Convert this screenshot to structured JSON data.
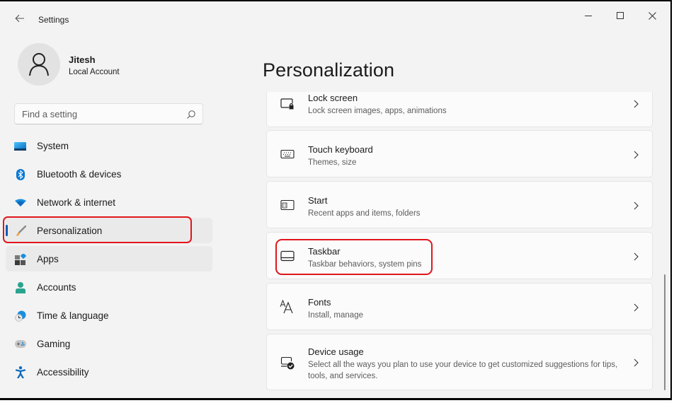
{
  "window": {
    "title": "Settings",
    "controls": {
      "minimize": "minimize-icon",
      "maximize": "maximize-icon",
      "close": "close-icon"
    }
  },
  "profile": {
    "name": "Jitesh",
    "account_type": "Local Account",
    "avatar_icon": "person-icon"
  },
  "search": {
    "placeholder": "Find a setting",
    "value": "",
    "icon": "search-icon"
  },
  "sidebar": {
    "items": [
      {
        "label": "System",
        "icon": "system-icon",
        "selected": false
      },
      {
        "label": "Bluetooth & devices",
        "icon": "bluetooth-icon",
        "selected": false
      },
      {
        "label": "Network & internet",
        "icon": "wifi-icon",
        "selected": false
      },
      {
        "label": "Personalization",
        "icon": "brush-icon",
        "selected": true
      },
      {
        "label": "Apps",
        "icon": "apps-icon",
        "selected": false
      },
      {
        "label": "Accounts",
        "icon": "account-icon",
        "selected": false
      },
      {
        "label": "Time & language",
        "icon": "clock-globe-icon",
        "selected": false
      },
      {
        "label": "Gaming",
        "icon": "gamepad-icon",
        "selected": false
      },
      {
        "label": "Accessibility",
        "icon": "accessibility-icon",
        "selected": false
      }
    ]
  },
  "main": {
    "title": "Personalization",
    "cards": [
      {
        "title": "Lock screen",
        "subtitle": "Lock screen images, apps, animations",
        "icon": "lock-screen-icon"
      },
      {
        "title": "Touch keyboard",
        "subtitle": "Themes, size",
        "icon": "keyboard-icon"
      },
      {
        "title": "Start",
        "subtitle": "Recent apps and items, folders",
        "icon": "start-icon"
      },
      {
        "title": "Taskbar",
        "subtitle": "Taskbar behaviors, system pins",
        "icon": "taskbar-icon"
      },
      {
        "title": "Fonts",
        "subtitle": "Install, manage",
        "icon": "fonts-icon"
      },
      {
        "title": "Device usage",
        "subtitle": "Select all the ways you plan to use your device to get customized suggestions for tips, tools, and services.",
        "icon": "device-usage-icon"
      }
    ]
  },
  "annotations": {
    "highlight_color": "#e0161b",
    "highlighted": [
      "Personalization",
      "Taskbar"
    ]
  },
  "colors": {
    "accent": "#005fb8",
    "background": "#f3f3f3",
    "card": "#fbfbfb"
  }
}
